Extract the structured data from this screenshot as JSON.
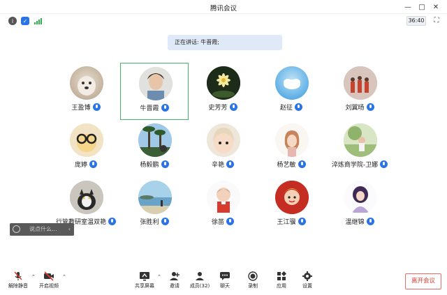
{
  "window": {
    "title": "腾讯会议"
  },
  "toolbar": {
    "timer": "36:40"
  },
  "speaking_banner": "正在讲话: 牛晋霞;",
  "participants": [
    {
      "name": "王盈博"
    },
    {
      "name": "牛晋霞"
    },
    {
      "name": "史芳芳"
    },
    {
      "name": "赵征"
    },
    {
      "name": "刘翼旸"
    },
    {
      "name": "庞婷"
    },
    {
      "name": "杨毅鹏"
    },
    {
      "name": "辛艳"
    },
    {
      "name": "杨艺敏"
    },
    {
      "name": "淬炼商学院-卫娜"
    },
    {
      "name": "行管教研室温双艳"
    },
    {
      "name": "张胜利"
    },
    {
      "name": "徐苗"
    },
    {
      "name": "王江骥"
    },
    {
      "name": "温继锦"
    }
  ],
  "chat": {
    "placeholder": "说点什么..."
  },
  "bottom": {
    "unmute": "解除静音",
    "video": "开启视频",
    "share": "共享屏幕",
    "invite": "邀请",
    "members": "成员(32)",
    "chat": "聊天",
    "record": "录制",
    "apps": "应用",
    "settings": "设置",
    "leave": "离开会议"
  },
  "colors": {
    "accent": "#2a74e8",
    "active_border": "#4cae6b",
    "leave": "#e03a2f"
  }
}
